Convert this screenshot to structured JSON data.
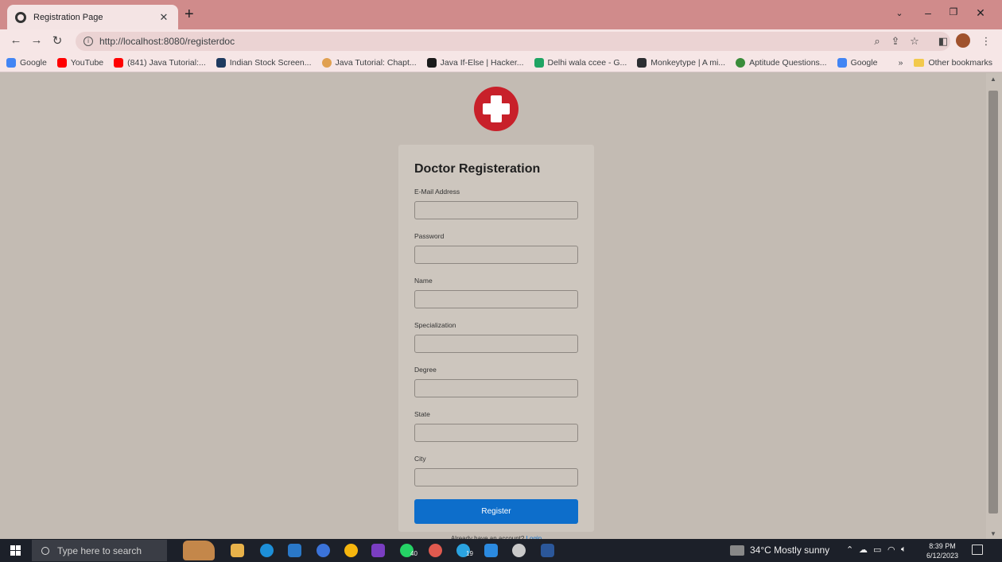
{
  "browser": {
    "tab_title": "Registration Page",
    "url": "http://localhost:8080/registerdoc",
    "bookmarks": [
      {
        "label": "Google",
        "color": "#4285f4"
      },
      {
        "label": "YouTube",
        "color": "#ff0000"
      },
      {
        "label": "(841) Java Tutorial:...",
        "color": "#ff0000"
      },
      {
        "label": "Indian Stock Screen...",
        "color": "#1e3a5f"
      },
      {
        "label": "Java Tutorial: Chapt...",
        "color": "#e0a050"
      },
      {
        "label": "Java If-Else | Hacker...",
        "color": "#1a1a1a"
      },
      {
        "label": "Delhi wala ccee - G...",
        "color": "#1fa463"
      },
      {
        "label": "Monkeytype | A mi...",
        "color": "#2c2e31"
      },
      {
        "label": "Aptitude Questions...",
        "color": "#3a8c3a"
      },
      {
        "label": "Google",
        "color": "#4285f4"
      }
    ],
    "more_bookmarks": "»",
    "other_bookmarks": "Other bookmarks"
  },
  "form": {
    "title": "Doctor Registeration",
    "fields": [
      {
        "label": "E-Mail Address"
      },
      {
        "label": "Password"
      },
      {
        "label": "Name"
      },
      {
        "label": "Specialization"
      },
      {
        "label": "Degree"
      },
      {
        "label": "State"
      },
      {
        "label": "City"
      }
    ],
    "submit_label": "Register",
    "login_prompt": "Already have an account?",
    "login_link": "Login"
  },
  "taskbar": {
    "search_placeholder": "Type here to search",
    "weather": "34°C  Mostly sunny",
    "time": "8:39 PM",
    "date": "6/12/2023",
    "badge_whatsapp": "40",
    "badge_telegram": "19"
  },
  "colors": {
    "brand_red": "#c8202a",
    "primary_button": "#0d6ecb",
    "page_background": "#c3bbb3"
  }
}
